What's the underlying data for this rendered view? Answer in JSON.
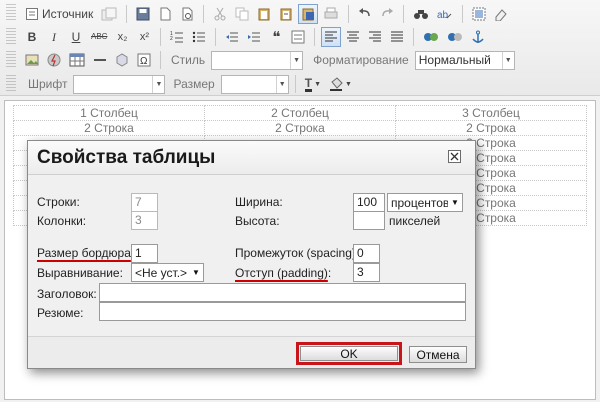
{
  "toolbar": {
    "source_label": "Источник",
    "style_label": "Стиль",
    "style_value": "",
    "format_label": "Форматирование",
    "format_value": "Нормальный",
    "font_label": "Шрифт",
    "font_value": "",
    "size_label": "Размер",
    "size_value": "",
    "bold": "B",
    "italic": "I",
    "underline": "U",
    "strike": "ABC",
    "subscript": "x₂",
    "superscript": "x²",
    "text_color": "T",
    "quote": "❝"
  },
  "editor": {
    "rows": [
      [
        "1 Столбец",
        "2 Столбец",
        "3 Столбец"
      ],
      [
        "2 Строка",
        "2 Строка",
        "2 Строка"
      ],
      [
        "",
        "",
        "2 Строка"
      ],
      [
        "",
        "",
        "2 Строка"
      ],
      [
        "",
        "",
        "2 Строка"
      ],
      [
        "",
        "",
        "2 Строка"
      ],
      [
        "",
        "",
        "2 Строка"
      ],
      [
        "",
        "",
        "2 Строка"
      ]
    ]
  },
  "dialog": {
    "title": "Свойства таблицы",
    "rows_label": "Строки:",
    "rows_value": "7",
    "cols_label": "Колонки:",
    "cols_value": "3",
    "border_label": "Размер бордюра",
    "border_colon": ":",
    "border_value": "1",
    "align_label": "Выравнивание:",
    "align_value": "<Не уст.>",
    "width_label": "Ширина:",
    "width_value": "100",
    "width_unit": "процентов",
    "height_label": "Высота:",
    "height_value": "",
    "height_unit": "пикселей",
    "spacing_label": "Промежуток (spacing):",
    "spacing_value": "0",
    "padding_label": "Отступ (padding)",
    "padding_colon": ":",
    "padding_value": "3",
    "caption_label": "Заголовок:",
    "caption_value": "",
    "summary_label": "Резюме:",
    "summary_value": "",
    "ok_label": "OK",
    "cancel_label": "Отмена"
  },
  "colors": {
    "highlight": "#c8141b",
    "active_border": "#7da2ce"
  }
}
